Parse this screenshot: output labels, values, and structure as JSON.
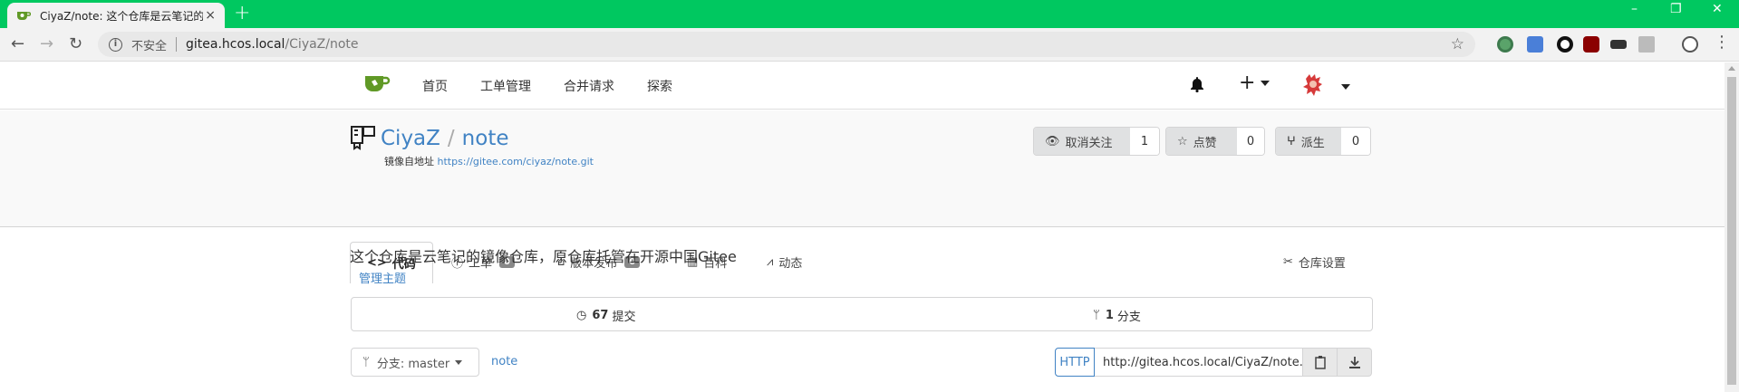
{
  "browser": {
    "tab_title": "CiyaZ/note: 这个仓库是云笔记的",
    "tab_close": "×",
    "new_tab": "+",
    "insecure_label": "不安全",
    "url_host": "gitea.hcos.local",
    "url_path": "/CiyaZ/note",
    "window_controls": [
      "–",
      "❐",
      "✕"
    ]
  },
  "nav": {
    "items": [
      "首页",
      "工单管理",
      "合并请求",
      "探索"
    ],
    "plus": "+"
  },
  "repo": {
    "owner": "CiyaZ",
    "separator": "/",
    "name": "note",
    "mirror_label": "镜像自地址",
    "mirror_url": "https://gitee.com/ciyaz/note.git",
    "watch_label": "取消关注",
    "watch_count": "1",
    "star_label": "点赞",
    "star_count": "0",
    "fork_label": "派生",
    "fork_count": "0"
  },
  "tabs": {
    "code": "代码",
    "issues": "工单",
    "issues_count": "0",
    "releases": "版本发布",
    "releases_count": "0",
    "wiki": "百科",
    "activity": "动态",
    "settings": "仓库设置"
  },
  "description": "这个仓库是云笔记的镜像仓库，原仓库托管在开源中国Gitee",
  "topics_link": "管理主题",
  "stats": {
    "commits_count": "67",
    "commits_label": "提交",
    "branches_count": "1",
    "branches_label": "分支"
  },
  "branch": {
    "label": "分支: master",
    "path": "note"
  },
  "clone": {
    "protocol": "HTTP",
    "url": "http://gitea.hcos.local/CiyaZ/note.git"
  },
  "colors": {
    "browser_frame": "#00c860",
    "link": "#4183c4",
    "gitea_green": "#609926"
  }
}
